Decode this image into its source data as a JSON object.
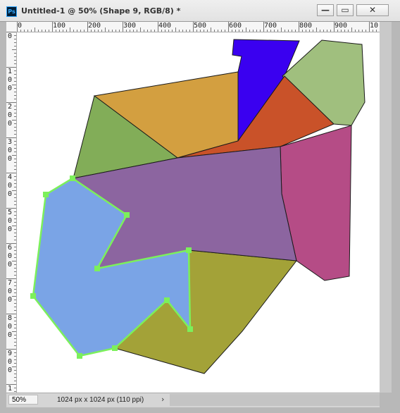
{
  "window": {
    "app_icon_text": "Ps",
    "title": "Untitled-1 @ 50% (Shape 9, RGB/8) *",
    "minimize_glyph": "—",
    "maximize_glyph": "▭",
    "close_glyph": "✕"
  },
  "ruler": {
    "top_labels": [
      "0",
      "100",
      "200",
      "300",
      "400",
      "500",
      "600",
      "700",
      "800",
      "900",
      "10"
    ],
    "left_labels": [
      "0",
      "100",
      "200",
      "300",
      "400",
      "500",
      "600",
      "700",
      "800",
      "900",
      "1"
    ]
  },
  "status": {
    "zoom": "50%",
    "doc_info": "1024 px x 1024 px (110 ppi)",
    "menu_arrow": "›"
  },
  "artwork": {
    "shapes": [
      {
        "name": "orange-polygon",
        "fill": "#d39f40"
      },
      {
        "name": "green-triangle",
        "fill": "#82ad58"
      },
      {
        "name": "blue-polygon",
        "fill": "#3a00f0"
      },
      {
        "name": "light-green-polygon",
        "fill": "#a0bf7e"
      },
      {
        "name": "red-orange-polygon",
        "fill": "#c95229"
      },
      {
        "name": "magenta-polygon",
        "fill": "#b54c86"
      },
      {
        "name": "olive-polygon",
        "fill": "#a3a238"
      },
      {
        "name": "purple-polygon",
        "fill": "#8c65a0"
      },
      {
        "name": "selected-light-blue-shape",
        "fill": "#7aa4e6",
        "selection_color": "#7cf05b"
      }
    ]
  }
}
